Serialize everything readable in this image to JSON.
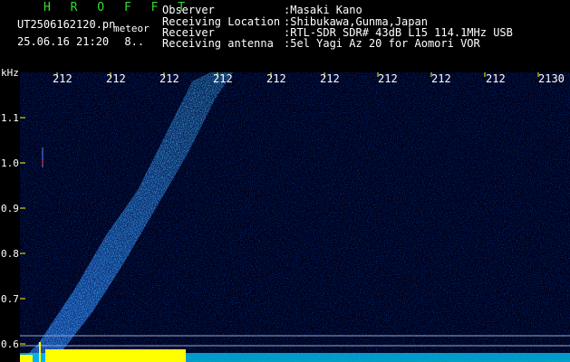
{
  "header": {
    "app_title": "H R O F F T",
    "filename": "UT2506162120.pn",
    "tag": "meteor",
    "timestamp": "25.06.16 21:20",
    "timestamp_extra": "8..",
    "info": [
      {
        "label": "Observer",
        "value": ":Masaki Kano"
      },
      {
        "label": "Receiving Location",
        "value": ":Shibukawa,Gunma,Japan"
      },
      {
        "label": "Receiver",
        "value": ":RTL-SDR SDR# 43dB L15 114.1MHz USB"
      },
      {
        "label": "Receiving antenna",
        "value": ":5el Yagi Az 20 for Aomori VOR"
      }
    ]
  },
  "axes": {
    "y_unit": "kHz",
    "y_ticks": [
      "1.1",
      "1.0",
      "0.9",
      "0.8",
      "0.7",
      "0.6"
    ],
    "x_ticks": [
      "212",
      "212",
      "212",
      "212",
      "212",
      "212",
      "212",
      "212",
      "212",
      "2130"
    ]
  },
  "colors": {
    "background": "#000000",
    "title_green": "#33dd33",
    "tick_yellow": "#ffff00",
    "baseline_yellow": "#ffff00",
    "baseline_cyan": "#00ccff"
  }
}
